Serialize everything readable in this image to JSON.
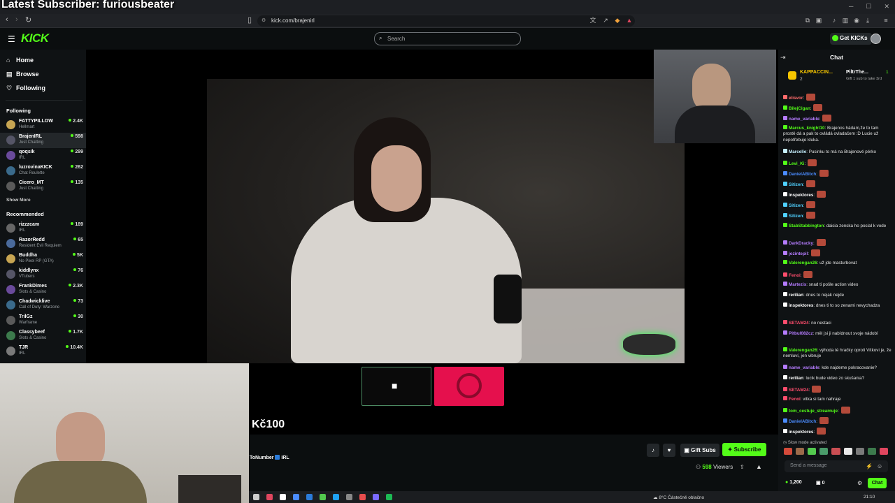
{
  "overlay": {
    "title": "Latest Subscriber: furiousbeater"
  },
  "browser": {
    "url": "kick.com/brajenirl"
  },
  "header": {
    "logo": "KICK",
    "search_placeholder": "Search",
    "get_kicks": "Get KICKs"
  },
  "sidebar": {
    "nav": [
      {
        "label": "Home",
        "icon": "home-icon"
      },
      {
        "label": "Browse",
        "icon": "browse-icon"
      },
      {
        "label": "Following",
        "icon": "heart-icon"
      }
    ],
    "following_title": "Following",
    "following": [
      {
        "name": "FATTYPILLOW",
        "category": "Hellmart",
        "count": "2.4K"
      },
      {
        "name": "BrajenIRL",
        "category": "Just Chatting",
        "count": "598"
      },
      {
        "name": "qoqsik",
        "category": "IRL",
        "count": "299"
      },
      {
        "name": "luzrovinaKICK",
        "category": "Chat Roulette",
        "count": "262"
      },
      {
        "name": "Cicero_MT",
        "category": "Just Chatting",
        "count": "135"
      }
    ],
    "show_more": "Show More",
    "recommended_title": "Recommended",
    "recommended": [
      {
        "name": "rizzzcam",
        "category": "IRL",
        "count": "189"
      },
      {
        "name": "RazorRedd",
        "category": "Resident Evil Requiem",
        "count": "65"
      },
      {
        "name": "Buddha",
        "category": "No Pixel RP (GTA)",
        "count": "5K"
      },
      {
        "name": "kiddlynx",
        "category": "VTubers",
        "count": "76"
      },
      {
        "name": "FrankDimes",
        "category": "Slots & Casino",
        "count": "2.3K"
      },
      {
        "name": "Chadwicklive",
        "category": "Call of Duty: Warzone",
        "count": "73"
      },
      {
        "name": "TrilGz",
        "category": "Warframe",
        "count": "30"
      },
      {
        "name": "Classybeef",
        "category": "Slots & Casino",
        "count": "1.7K"
      },
      {
        "name": "TJR",
        "category": "IRL",
        "count": "10.4K"
      }
    ]
  },
  "stream": {
    "price": "Kč100",
    "streamer_fragment": "ToNumber",
    "streamer_tag": "IRL",
    "gift_subs": "Gift Subs",
    "subscribe": "Subscribe",
    "viewers_count": "598",
    "viewers_label": "Viewers"
  },
  "chat": {
    "title": "Chat",
    "pinned_user": "KAPPACCIN...",
    "pinned_count": "2",
    "pinned_user2": "PiltrThe...",
    "pinned_count2": "1",
    "pinned_note": "Gift 1 sub to take 3rd",
    "messages": [
      {
        "user": "elisvor",
        "color": "#ff6b6b",
        "text": ""
      },
      {
        "user": "BilejCigan",
        "color": "#53fc18",
        "text": ""
      },
      {
        "user": "name_variable",
        "color": "#b57cff",
        "text": ""
      },
      {
        "user": "Marcus_knight10",
        "color": "#53fc18",
        "text": "Brajenos hádam,že to tam prostě dá a pak to ovládá ovladačem :D Lucie už nepotřebuje kluka."
      },
      {
        "user": "Marcelie",
        "color": "#c7f0ff",
        "text": "Pusinku to má na Brajenové pérko"
      },
      {
        "user": "Levi_Ki",
        "color": "#53fc18",
        "text": ""
      },
      {
        "user": "DanielABitch",
        "color": "#4b8cff",
        "text": ""
      },
      {
        "user": "Sitizen",
        "color": "#4fd1ff",
        "text": ""
      },
      {
        "user": "inspektores",
        "color": "#ffffff",
        "text": ""
      },
      {
        "user": "Sitizen",
        "color": "#4fd1ff",
        "text": ""
      },
      {
        "user": "Sitizen",
        "color": "#4fd1ff",
        "text": ""
      },
      {
        "user": "StabStabbington",
        "color": "#53fc18",
        "text": "daisia zenska ho poslal k vode"
      },
      {
        "user": "DarkDracky",
        "color": "#b57cff",
        "text": ""
      },
      {
        "user": "jozintepil",
        "color": "#b57cff",
        "text": ""
      },
      {
        "user": "Valerengan26",
        "color": "#53fc18",
        "text": "už jde masturbovat"
      },
      {
        "user": "Fenoi",
        "color": "#ff4d6d",
        "text": ""
      },
      {
        "user": "Martezis",
        "color": "#b57cff",
        "text": "snad ti pošle action video"
      },
      {
        "user": "rerilian",
        "color": "#ffffff",
        "text": "dnes to nejak nejde"
      },
      {
        "user": "inspektores",
        "color": "#ffffff",
        "text": "dnes ti to so zenami nevychadza"
      },
      {
        "user": "SETAM24",
        "color": "#ff4d6d",
        "text": "no   nestaci"
      },
      {
        "user": "Pitbul082cz",
        "color": "#b57cff",
        "text": "měl jsi ji nabídnout svoje nádobí"
      },
      {
        "user": "Valerengan26",
        "color": "#53fc18",
        "text": "výhoda té hračky oproti Vítkovi je, že nemluví, jen vibruje"
      },
      {
        "user": "name_variable",
        "color": "#b57cff",
        "text": "kde najdeme pokracovanie?"
      },
      {
        "user": "rerilian",
        "color": "#ffffff",
        "text": "lucik bude video zo skušania?"
      },
      {
        "user": "SETAM24",
        "color": "#ff4d6d",
        "text": ""
      },
      {
        "user": "Fenoi",
        "color": "#ff4d6d",
        "text": "vitka si tam nahraje"
      },
      {
        "user": "tom_cestuje_streamuje",
        "color": "#53fc18",
        "text": ""
      },
      {
        "user": "DanielABitch",
        "color": "#4b8cff",
        "text": ""
      },
      {
        "user": "inspektores",
        "color": "#ffffff",
        "text": ""
      }
    ],
    "slow_mode": "Slow mode activated",
    "input_placeholder": "Send a message",
    "kicks_balance": "1,200",
    "points": "0",
    "send_label": "Chat"
  },
  "taskbar": {
    "weather": "8°C  Částečně oblačno",
    "time": "21:10"
  }
}
